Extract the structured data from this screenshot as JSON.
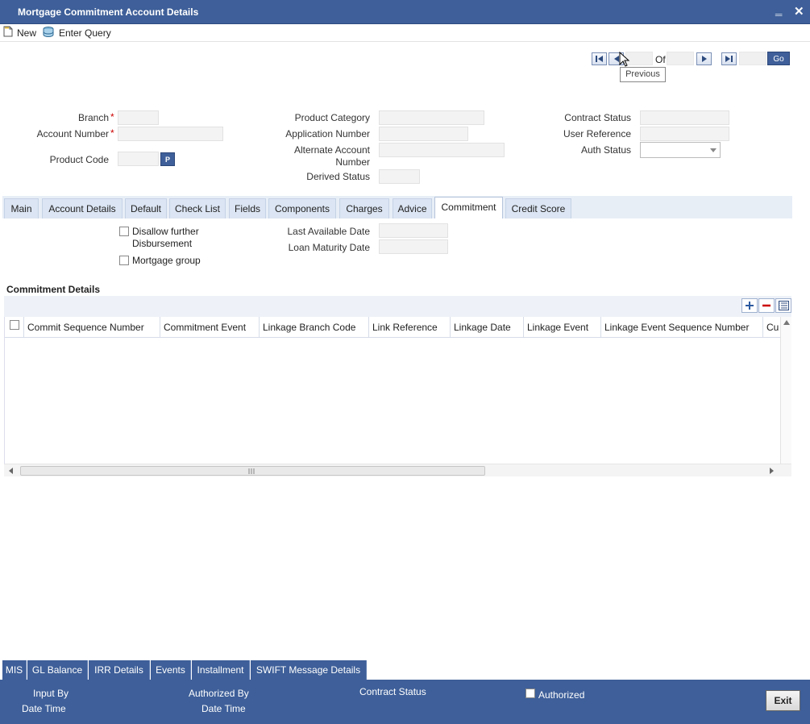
{
  "window": {
    "title": "Mortgage Commitment Account Details",
    "minimize_glyph": "‗",
    "close_glyph": "✕"
  },
  "toolbar": {
    "new_label": "New",
    "enter_query_label": "Enter Query"
  },
  "navigation": {
    "of_label": "Of",
    "go_label": "Go",
    "tooltip": "Previous"
  },
  "header_fields": {
    "branch_label": "Branch",
    "account_number_label": "Account Number",
    "product_code_label": "Product Code",
    "product_code_button": "P",
    "product_category_label": "Product Category",
    "application_number_label": "Application Number",
    "alternate_account_label_1": "Alternate Account",
    "alternate_account_label_2": "Number",
    "derived_status_label": "Derived Status",
    "contract_status_label": "Contract Status",
    "user_reference_label": "User Reference",
    "auth_status_label": "Auth Status",
    "required_mark": "*"
  },
  "tabs": [
    "Main",
    "Account Details",
    "Default",
    "Check List",
    "Fields",
    "Components",
    "Charges",
    "Advice",
    "Commitment",
    "Credit Score"
  ],
  "active_tab": "Commitment",
  "commitment": {
    "disallow_label_1": "Disallow further",
    "disallow_label_2": "Disbursement",
    "mortgage_group_label": "Mortgage group",
    "last_available_date_label": "Last Available Date",
    "loan_maturity_date_label": "Loan Maturity Date",
    "section_title": "Commitment Details",
    "columns": [
      "Commit Sequence Number",
      "Commitment Event",
      "Linkage Branch Code",
      "Link Reference",
      "Linkage Date",
      "Linkage Event",
      "Linkage Event Sequence Number",
      "Cu"
    ]
  },
  "bottom_tabs": [
    "MIS",
    "GL Balance",
    "IRR Details",
    "Events",
    "Installment",
    "SWIFT Message Details"
  ],
  "footer": {
    "input_by": "Input By",
    "date_time_1": "Date Time",
    "authorized_by": "Authorized By",
    "date_time_2": "Date Time",
    "contract_status": "Contract Status",
    "authorized": "Authorized",
    "exit": "Exit"
  },
  "icons": [
    "new-document-icon",
    "enter-query-icon",
    "first-record-icon",
    "previous-record-icon",
    "next-record-icon",
    "last-record-icon",
    "add-row-icon",
    "delete-row-icon",
    "single-view-icon",
    "dropdown-arrow-icon"
  ],
  "colors": {
    "titlebar": "#3e5f99",
    "required": "#c00000",
    "tab_bg": "#dbe5f3"
  }
}
